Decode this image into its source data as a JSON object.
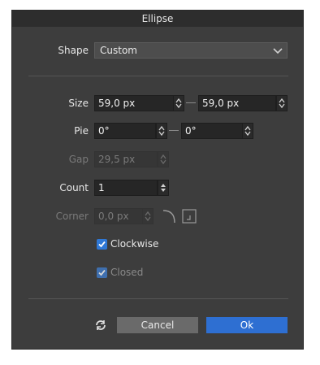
{
  "dialog": {
    "title": "Ellipse",
    "shape": {
      "label": "Shape",
      "value": "Custom"
    },
    "size": {
      "label": "Size",
      "width": "59,0 px",
      "height": "59,0 px"
    },
    "pie": {
      "label": "Pie",
      "start": "0°",
      "end": "0°"
    },
    "gap": {
      "label": "Gap",
      "value": "29,5 px",
      "enabled": false
    },
    "count": {
      "label": "Count",
      "value": "1"
    },
    "corner": {
      "label": "Corner",
      "value": "0,0 px",
      "enabled": false
    },
    "clockwise": {
      "label": "Clockwise",
      "checked": true
    },
    "closed": {
      "label": "Closed",
      "checked": true,
      "enabled": false
    },
    "buttons": {
      "cancel": "Cancel",
      "ok": "Ok"
    }
  },
  "colors": {
    "accent": "#2e6fd2",
    "background": "#3d3d3d",
    "field": "#262626"
  },
  "icons": [
    "chevron-down-icon",
    "spinner-icon",
    "refresh-icon",
    "corner-round-icon",
    "corner-inset-icon",
    "checkmark-icon"
  ]
}
